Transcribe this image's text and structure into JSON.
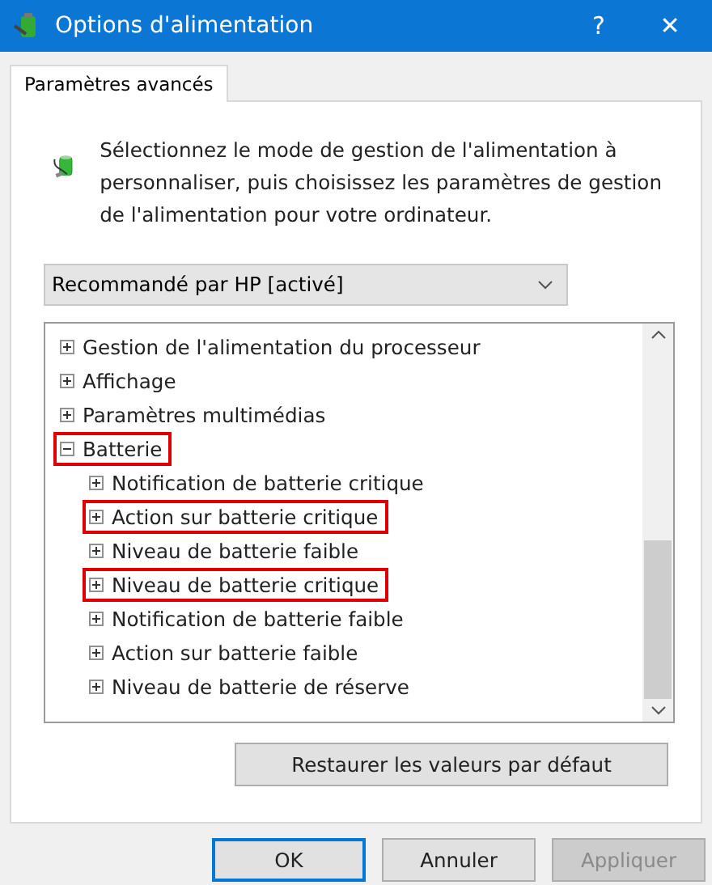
{
  "window": {
    "title": "Options d'alimentation",
    "help": "?",
    "close": "✕"
  },
  "tabs": [
    {
      "label": "Paramètres avancés",
      "selected": true
    }
  ],
  "description": "Sélectionnez le mode de gestion de l'alimentation à personnaliser, puis choisissez les paramètres de gestion de l'alimentation pour votre ordinateur.",
  "plan_dropdown": {
    "value": "Recommandé par HP [activé]"
  },
  "tree": [
    {
      "label": "Gestion de l'alimentation du processeur",
      "expanded": false,
      "highlighted": false
    },
    {
      "label": "Affichage",
      "expanded": false,
      "highlighted": false
    },
    {
      "label": "Paramètres multimédias",
      "expanded": false,
      "highlighted": false
    },
    {
      "label": "Batterie",
      "expanded": true,
      "highlighted": true,
      "children": [
        {
          "label": "Notification de batterie critique",
          "expanded": false,
          "highlighted": false
        },
        {
          "label": "Action sur batterie critique",
          "expanded": false,
          "highlighted": true
        },
        {
          "label": "Niveau de batterie faible",
          "expanded": false,
          "highlighted": false
        },
        {
          "label": "Niveau de batterie critique",
          "expanded": false,
          "highlighted": true
        },
        {
          "label": "Notification de batterie faible",
          "expanded": false,
          "highlighted": false
        },
        {
          "label": "Action sur batterie faible",
          "expanded": false,
          "highlighted": false
        },
        {
          "label": "Niveau de batterie de réserve",
          "expanded": false,
          "highlighted": false
        }
      ]
    }
  ],
  "restore_button": "Restaurer les valeurs par défaut",
  "buttons": [
    {
      "label": "OK",
      "default": true,
      "disabled": false
    },
    {
      "label": "Annuler",
      "default": false,
      "disabled": false
    },
    {
      "label": "Appliquer",
      "default": false,
      "disabled": true
    }
  ]
}
